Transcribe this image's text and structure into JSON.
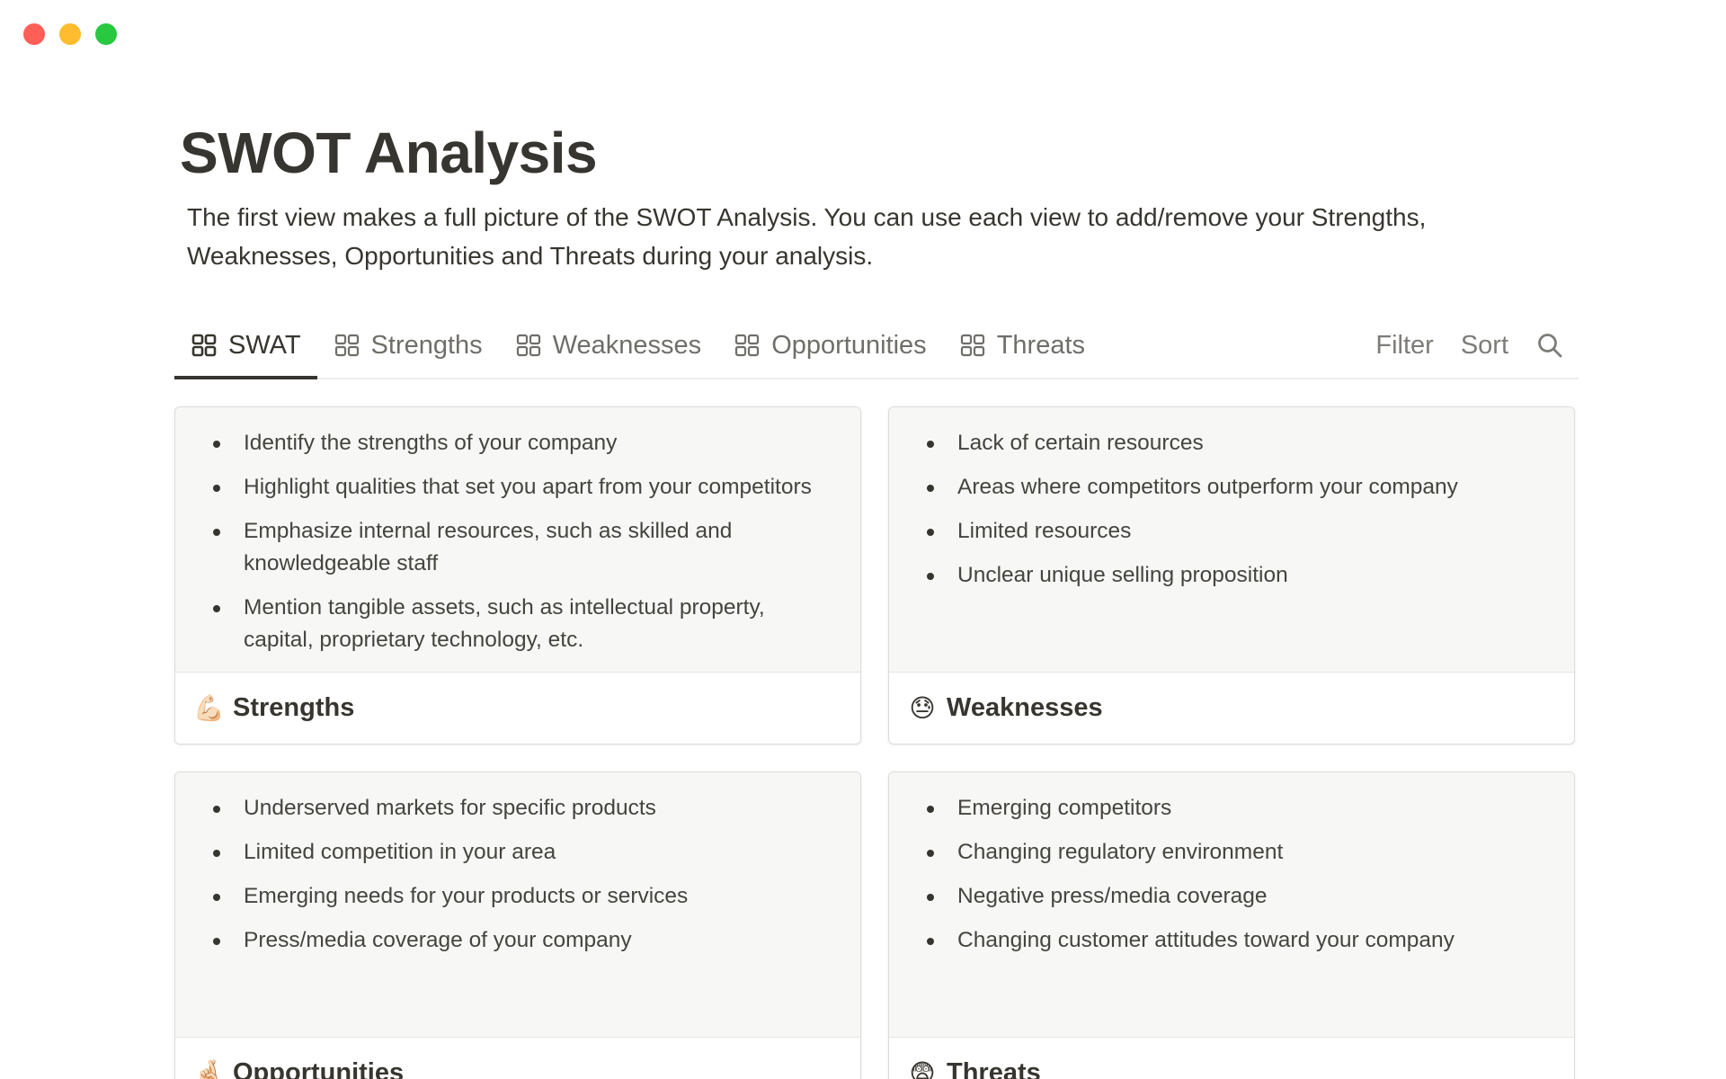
{
  "window": {
    "controls": {
      "close_color": "#ff5f57",
      "minimize_color": "#febc2e",
      "maximize_color": "#28c840"
    }
  },
  "page": {
    "title": "SWOT Analysis",
    "description": "The first view makes a full picture of the SWOT Analysis. You can use each view to add/remove your Strengths, Weaknesses, Opportunities and Threats during your analysis."
  },
  "tabs": [
    {
      "label": "SWAT",
      "icon": "gallery-icon",
      "active": true
    },
    {
      "label": "Strengths",
      "icon": "gallery-icon",
      "active": false
    },
    {
      "label": "Weaknesses",
      "icon": "gallery-icon",
      "active": false
    },
    {
      "label": "Opportunities",
      "icon": "gallery-icon",
      "active": false
    },
    {
      "label": "Threats",
      "icon": "gallery-icon",
      "active": false
    }
  ],
  "toolbar": {
    "filter_label": "Filter",
    "sort_label": "Sort",
    "search_icon": "search-icon"
  },
  "cards": [
    {
      "title": "Strengths",
      "emoji": "💪🏻",
      "bullets": [
        "Identify the strengths of your company",
        "Highlight qualities that set you apart from your competitors",
        "Emphasize internal resources, such as skilled and knowledgeable staff",
        "Mention tangible assets, such as intellectual property, capital, proprietary technology, etc."
      ]
    },
    {
      "title": "Weaknesses",
      "emoji": "😓",
      "bullets": [
        "Lack of certain resources",
        "Areas where competitors outperform your company",
        "Limited resources",
        "Unclear unique selling proposition"
      ]
    },
    {
      "title": "Opportunities",
      "emoji": "🤞🏻",
      "bullets": [
        "Underserved markets for specific products",
        "Limited competition in your area",
        "Emerging needs for your products or services",
        "Press/media coverage of your company"
      ]
    },
    {
      "title": "Threats",
      "emoji": "😨",
      "bullets": [
        "Emerging competitors",
        "Changing regulatory environment",
        "Negative press/media coverage",
        "Changing customer attitudes toward your company"
      ]
    }
  ]
}
